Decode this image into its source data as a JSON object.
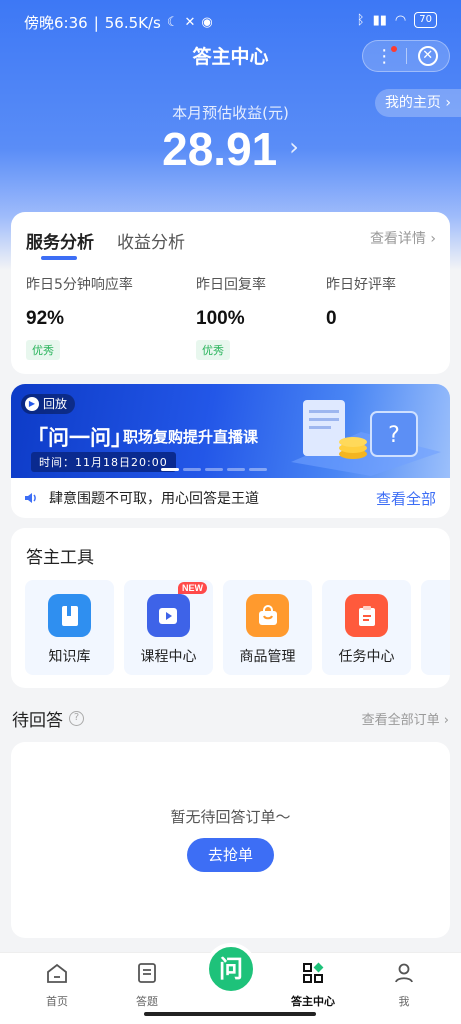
{
  "status_bar": {
    "time": "傍晚6:36",
    "speed": "56.5K/s",
    "battery": "70"
  },
  "nav": {
    "title": "答主中心",
    "my_homepage": "我的主页"
  },
  "earnings": {
    "label": "本月预估收益(元)",
    "value": "28.91"
  },
  "service": {
    "tabs": [
      "服务分析",
      "收益分析"
    ],
    "detail_link": "查看详情",
    "metrics": [
      {
        "label": "昨日5分钟响应率",
        "value": "92%",
        "badge": "优秀"
      },
      {
        "label": "昨日回复率",
        "value": "100%",
        "badge": "优秀"
      },
      {
        "label": "昨日好评率",
        "value": "0"
      }
    ]
  },
  "banner": {
    "replay": "回放",
    "title": "「问一问」",
    "subtitle": "职场复购提升直播课",
    "time": "时间：11月18日20:00",
    "notice": "肆意围题不可取，用心回答是王道",
    "view_all": "查看全部"
  },
  "tools": {
    "title": "答主工具",
    "items": [
      {
        "name": "知识库",
        "color": "#2f8ff0"
      },
      {
        "name": "课程中心",
        "color": "#3e63e8",
        "tag": "NEW"
      },
      {
        "name": "商品管理",
        "color": "#ff9a2e"
      },
      {
        "name": "任务中心",
        "color": "#ff5a3c"
      }
    ]
  },
  "pending": {
    "title": "待回答",
    "orders_link": "查看全部订单",
    "empty_text": "暂无待回答订单～",
    "grab_button": "去抢单"
  },
  "tabbar": {
    "items": [
      "首页",
      "答题",
      "答主中心",
      "我"
    ],
    "center_glyph": "问",
    "active": "答主中心"
  }
}
